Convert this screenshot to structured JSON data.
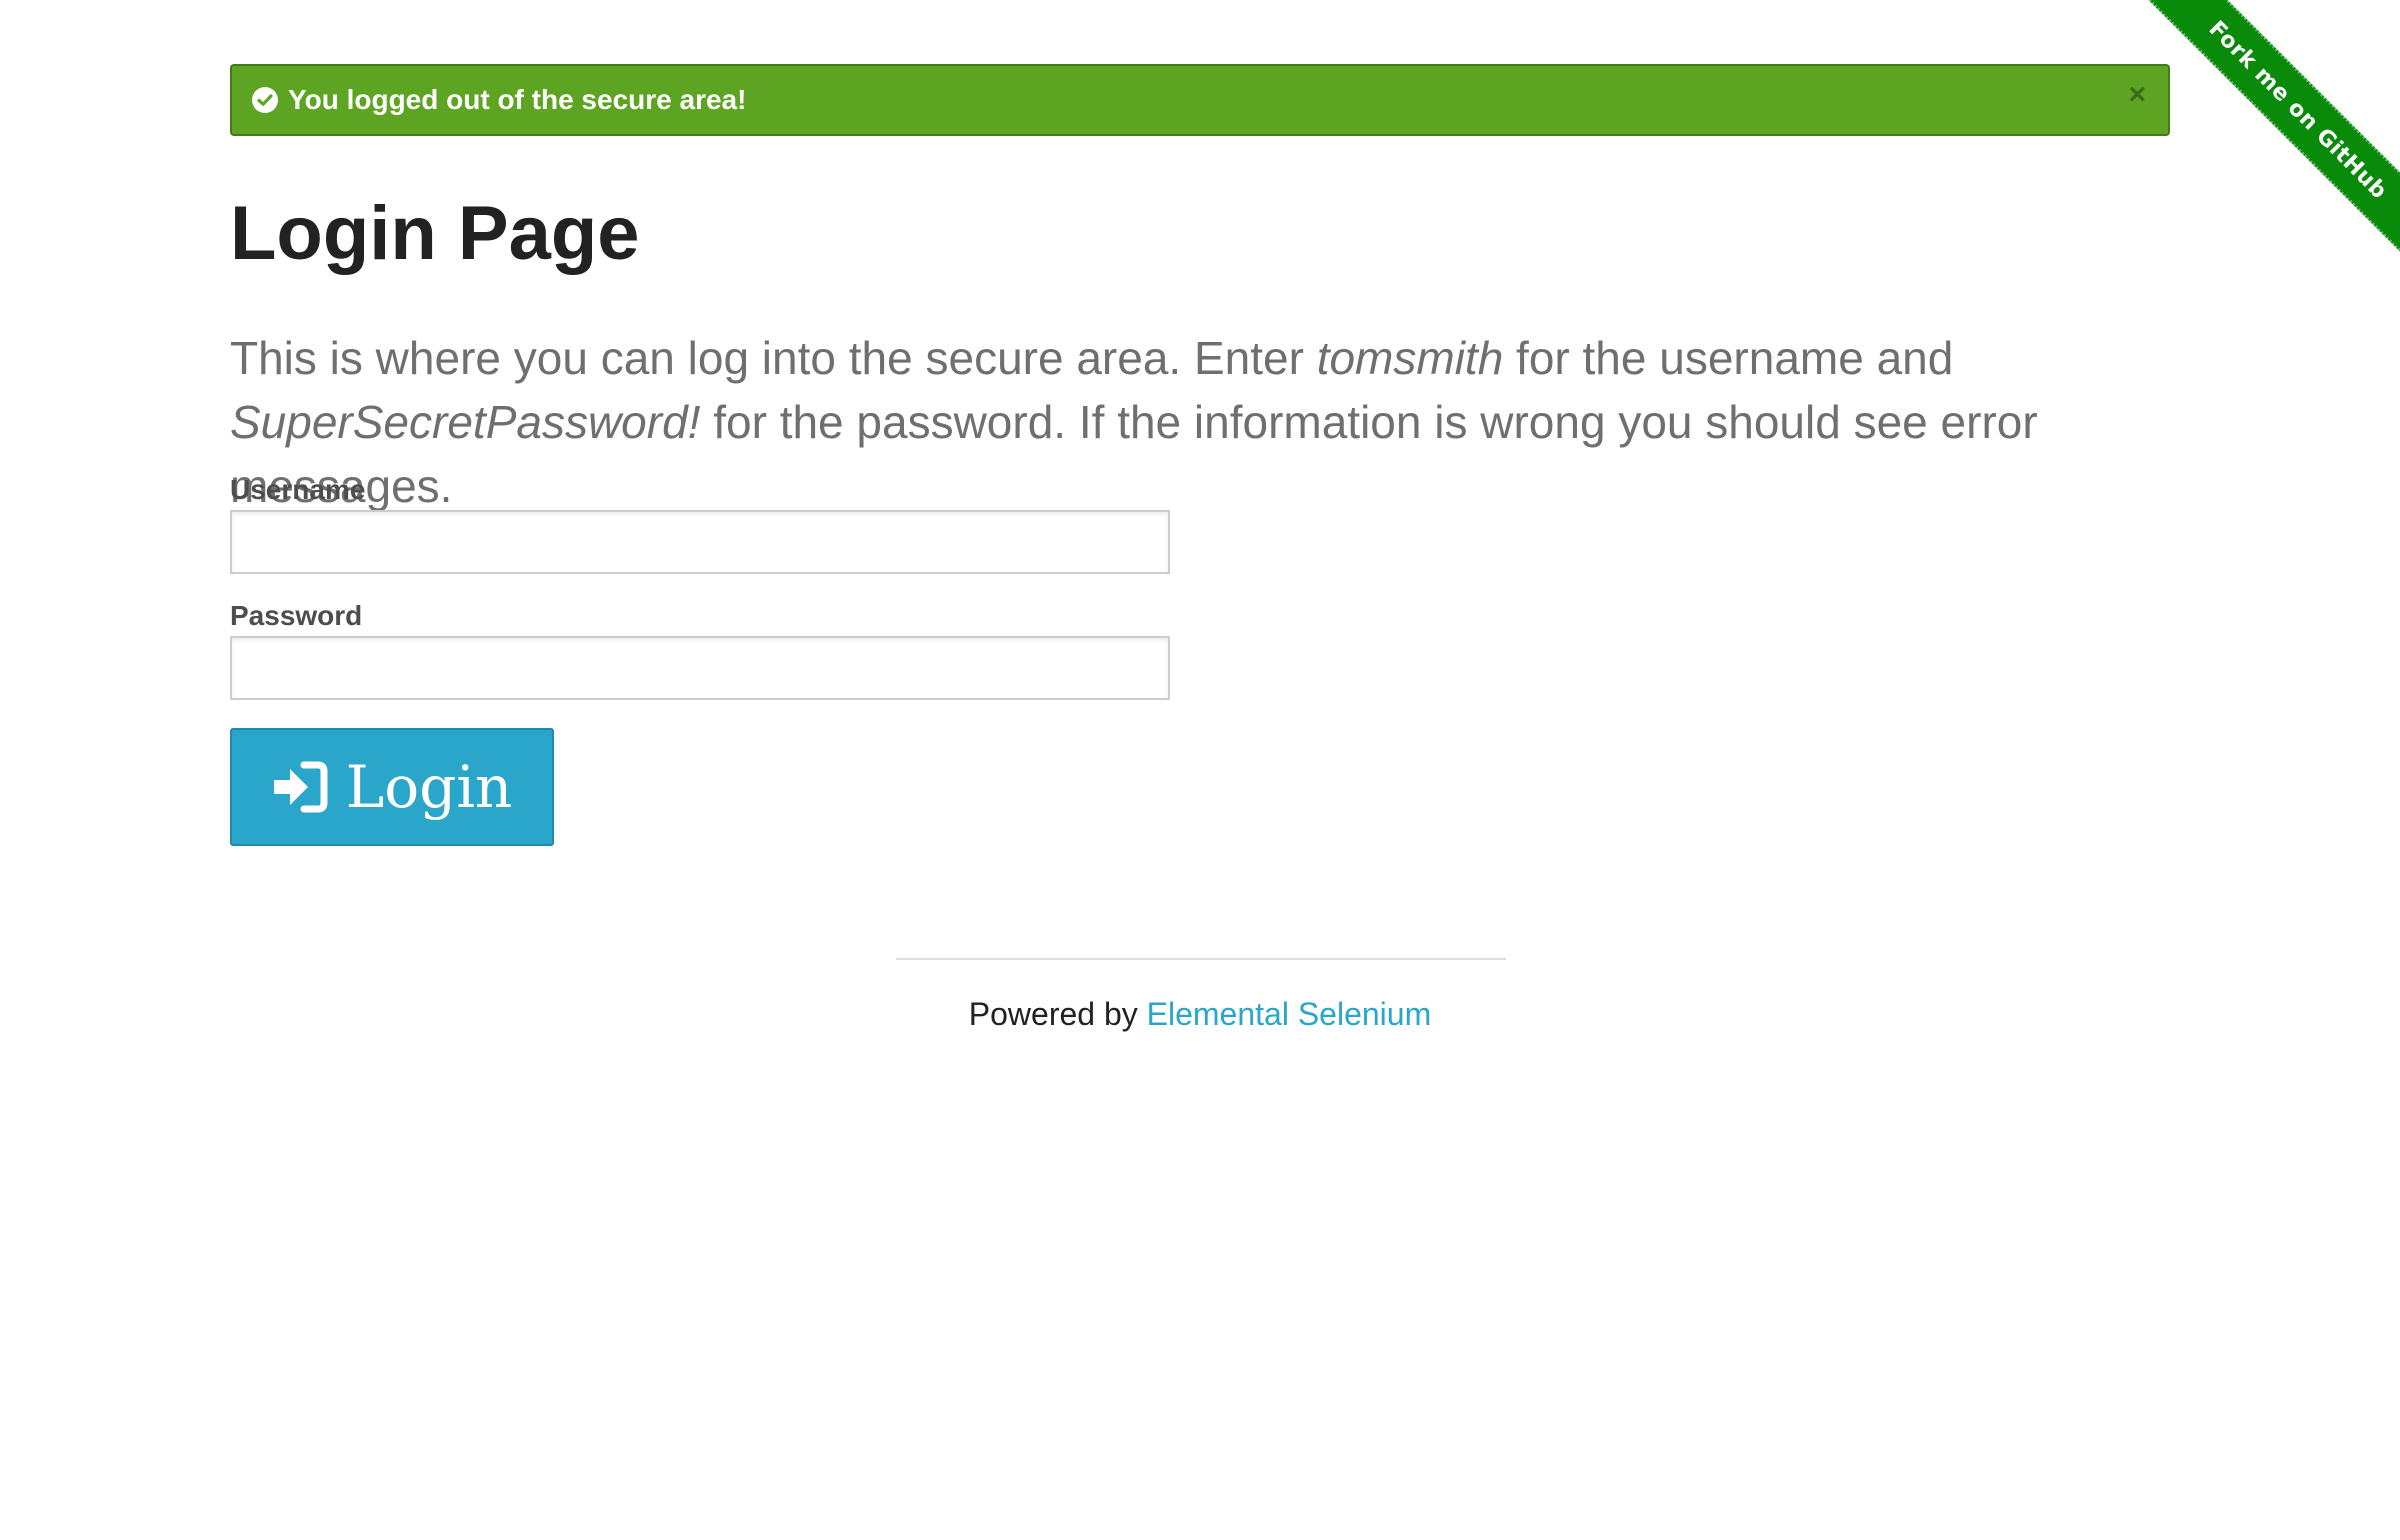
{
  "ribbon": {
    "label": "Fork me on GitHub",
    "color": "#098b09"
  },
  "flash": {
    "message": "You logged out of the secure area!",
    "close_glyph": "×",
    "icon": "check-circle-icon",
    "color": "#5da423"
  },
  "page": {
    "title": "Login Page",
    "intro": {
      "part1": "This is where you can log into the secure area. Enter ",
      "username_hint": "tomsmith",
      "part2": " for the username and ",
      "password_hint": "SuperSecretPassword!",
      "part3": " for the password. If the information is wrong you should see error messages."
    }
  },
  "form": {
    "username_label": "Username",
    "username_value": "",
    "password_label": "Password",
    "password_value": "",
    "submit_label": "Login",
    "submit_icon": "sign-in-icon",
    "submit_color": "#2ba6cb"
  },
  "footer": {
    "prefix": "Powered by ",
    "link_text": "Elemental Selenium",
    "link_color": "#2ba6cb"
  }
}
